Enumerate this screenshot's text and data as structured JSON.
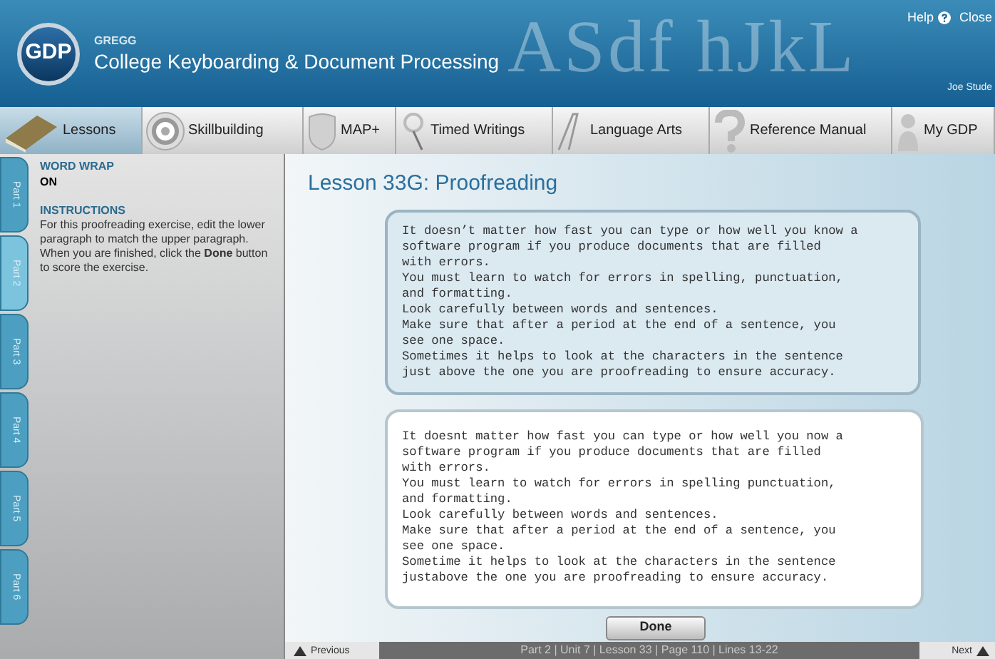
{
  "header": {
    "logo": "GDP",
    "brand": "GREGG",
    "title": "College Keyboarding & Document Processing",
    "background_letters": "ASdf hJkL",
    "help": "Help",
    "close": "Close",
    "user": "Joe Stude"
  },
  "nav_tabs": [
    {
      "label": "Lessons",
      "selected": true
    },
    {
      "label": "Skillbuilding",
      "selected": false
    },
    {
      "label": "MAP+",
      "selected": false
    },
    {
      "label": "Timed Writings",
      "selected": false
    },
    {
      "label": "Language Arts",
      "selected": false
    },
    {
      "label": "Reference Manual",
      "selected": false
    },
    {
      "label": "My GDP",
      "selected": false
    }
  ],
  "part_tabs": [
    {
      "label": "Part 1",
      "selected": false
    },
    {
      "label": "Part 2",
      "selected": true
    },
    {
      "label": "Part 3",
      "selected": false
    },
    {
      "label": "Part 4",
      "selected": false
    },
    {
      "label": "Part 5",
      "selected": false
    },
    {
      "label": "Part 6",
      "selected": false
    }
  ],
  "sidebar": {
    "word_wrap_heading": "WORD WRAP",
    "word_wrap_value": "ON",
    "instructions_heading": "INSTRUCTIONS",
    "instructions": "For this proofreading exercise, edit the lower paragraph to match the upper paragraph. When you are finished, click the **Done** button to score the exercise."
  },
  "lesson_title": "Lesson 33G: Proofreading",
  "original_text": "It doesn’t matter how fast you can type or how well you know a\nsoftware program if you produce documents that are filled\nwith errors.\nYou must learn to watch for errors in spelling, punctuation,\nand formatting.\nLook carefully between words and sentences.\nMake sure that after a period at the end of a sentence, you\nsee one space.\nSometimes it helps to look at the characters in the sentence\njust above the one you are proofreading to ensure accuracy.",
  "edit_text": "It doesnt matter how fast you can type or how well you now a\nsoftware program if you produce documents that are filled\nwith errors.\nYou must learn to watch for errors in spelling punctuation,\nand formatting.\nLook carefully between words and sentences.\nMake sure that after a period at the end of a sentence, you\nsee one space.\nSometime it helps to look at the characters in the sentence\njustabove the one you are proofreading to ensure accuracy.",
  "done_button": "Done",
  "footer": {
    "previous": "Previous",
    "location": "Part 2 | Unit 7 | Lesson 33 | Page 110 | Lines 13-22",
    "next": "Next"
  }
}
